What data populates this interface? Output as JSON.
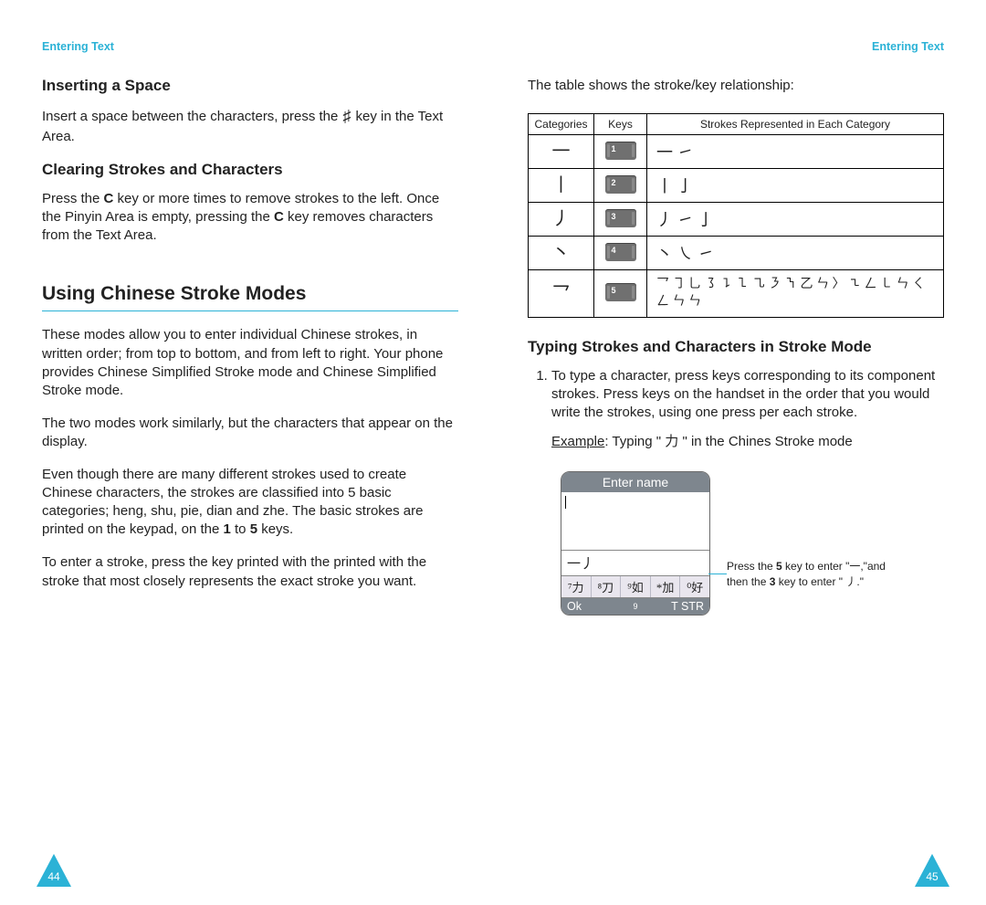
{
  "runhead": "Entering Text",
  "left": {
    "h2a": "Inserting a Space",
    "p1a": "Insert a space between the characters, press the ",
    "p1_hash": "♯",
    "p1b": " key in the Text Area.",
    "h2b": "Clearing Strokes and Characters",
    "p2a": "Press the ",
    "p2b": " key or more times to remove strokes to the left. Once the Pinyin Area is empty, pressing the ",
    "p2c": " key removes characters from the Text Area.",
    "bold_C": "C",
    "h1": "Using Chinese Stroke Modes",
    "p3": "These modes allow you to enter individual Chinese strokes, in written order; from top to bottom, and from left to right. Your phone provides Chinese Simplified Stroke mode and Chinese Simplified Stroke mode.",
    "p4": "The two modes work similarly, but the characters that appear on the display.",
    "p5a": "Even though there are many different strokes used to create Chinese characters, the strokes are classified into 5 basic categories; heng, shu, pie, dian and zhe. The basic strokes are printed on the keypad, on the ",
    "p5_1": "1",
    "p5_mid": " to ",
    "p5_5": "5",
    "p5b": " keys.",
    "p6": "To enter a stroke, press the key printed with the printed with the stroke that most closely represents the exact stroke you want.",
    "pagenum": "44"
  },
  "right": {
    "intro": "The table shows the stroke/key relationship:",
    "th1": "Categories",
    "th2": "Keys",
    "th3": "Strokes Represented in Each Category",
    "rows": [
      {
        "cat": "一",
        "key": "1",
        "strokes": "一 ㇀"
      },
      {
        "cat": "丨",
        "key": "2",
        "strokes": "丨 亅"
      },
      {
        "cat": "丿",
        "key": "3",
        "strokes": "丿 ㇀ 亅"
      },
      {
        "cat": "丶",
        "key": "4",
        "strokes": "丶 ㇏ ㇀"
      },
      {
        "cat": "乛",
        "key": "5",
        "strokes": "乛 ㇆ 乚 ㇌ ㇊ ㇅ ㇈ ㇋ ㇎ 乙 ㄣ 〉 ㇍ ㄥ ㇄ ㄣ ㄑ ㄥ ㄣ ㄣ"
      }
    ],
    "h2c": "Typing Strokes and Characters in Stroke Mode",
    "li1": "To type a character, press keys corresponding to its component strokes. Press keys on the handset in the order that you would write the strokes, using one press per each stroke.",
    "example_label": "Example",
    "example_text_a": ": Typing \" ",
    "example_char": "力",
    "example_text_b": " \" in the Chines Stroke mode",
    "phone": {
      "title": "Enter name",
      "strokes_line": "一丿",
      "cands": [
        "⁷力",
        "⁸刀",
        "⁹如",
        "*加",
        "⁰好"
      ],
      "soft_l": "Ok",
      "soft_m": "9",
      "soft_r": "T STR"
    },
    "caption_a": "Press the ",
    "caption_5": "5",
    "caption_b": " key to enter \"一,\"and then the ",
    "caption_3": "3",
    "caption_c": " key to enter \" 丿.\"",
    "pagenum": "45"
  }
}
